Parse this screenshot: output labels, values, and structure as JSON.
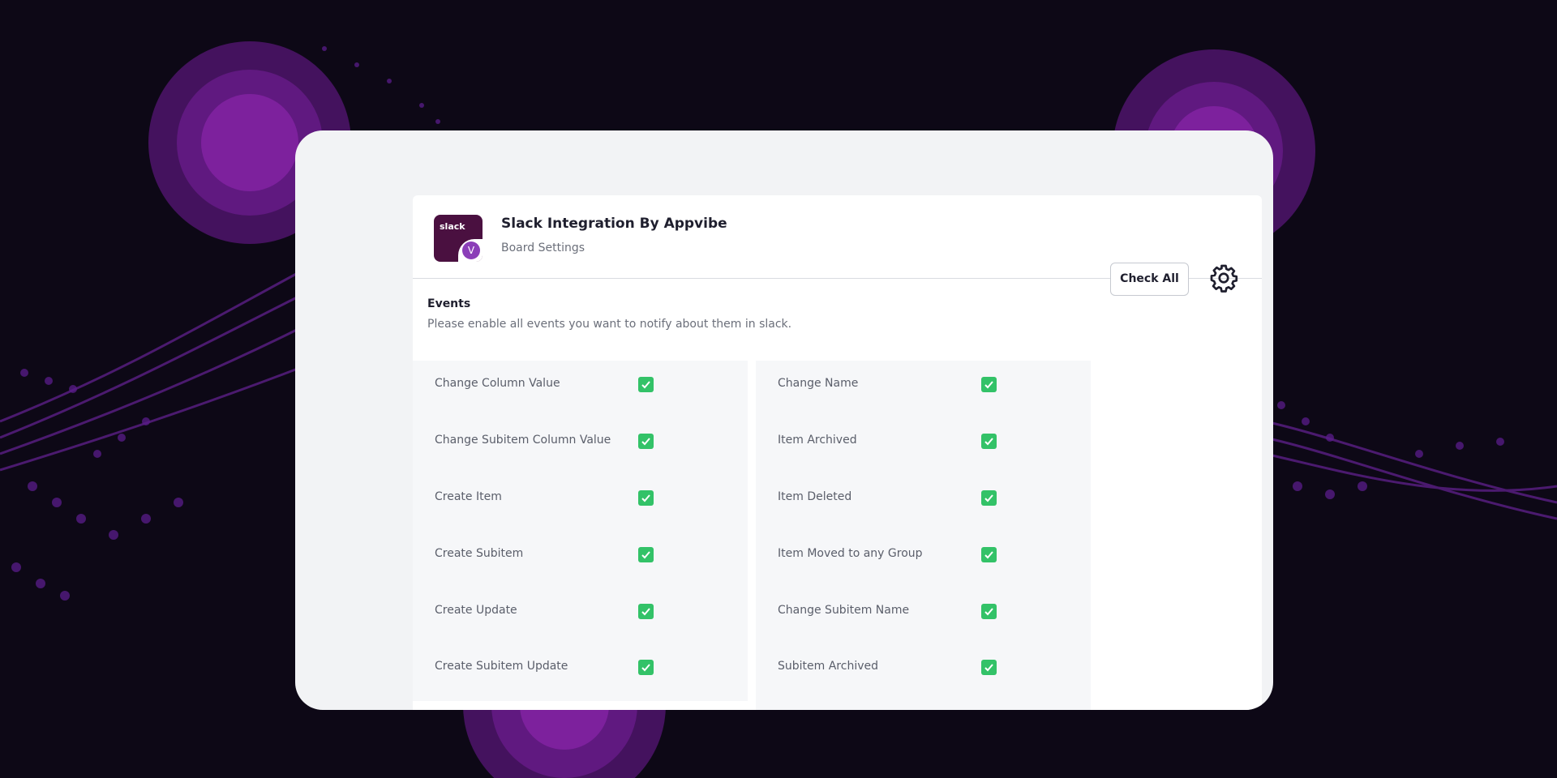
{
  "app": {
    "title": "Slack Integration By Appvibe",
    "subtitle": "Board Settings",
    "logo_text": "slack",
    "logo_badge": "V"
  },
  "toolbar": {
    "check_all_label": "Check All",
    "settings_icon": "gear-icon"
  },
  "events": {
    "title": "Events",
    "description": "Please enable all events you want to notify about them in slack.",
    "left": [
      {
        "label": "Change Column Value",
        "checked": true
      },
      {
        "label": "Change Subitem Column Value",
        "checked": true
      },
      {
        "label": "Create Item",
        "checked": true
      },
      {
        "label": "Create Subitem",
        "checked": true
      },
      {
        "label": "Create Update",
        "checked": true
      },
      {
        "label": "Create Subitem Update",
        "checked": true
      }
    ],
    "right": [
      {
        "label": "Change Name",
        "checked": true
      },
      {
        "label": "Item Archived",
        "checked": true
      },
      {
        "label": "Item Deleted",
        "checked": true
      },
      {
        "label": "Item Moved to any Group",
        "checked": true
      },
      {
        "label": "Change Subitem Name",
        "checked": true
      },
      {
        "label": "Subitem Archived",
        "checked": true
      }
    ]
  },
  "colors": {
    "background": "#0d0816",
    "accent": "#8b3fb8",
    "check": "#33c268"
  }
}
